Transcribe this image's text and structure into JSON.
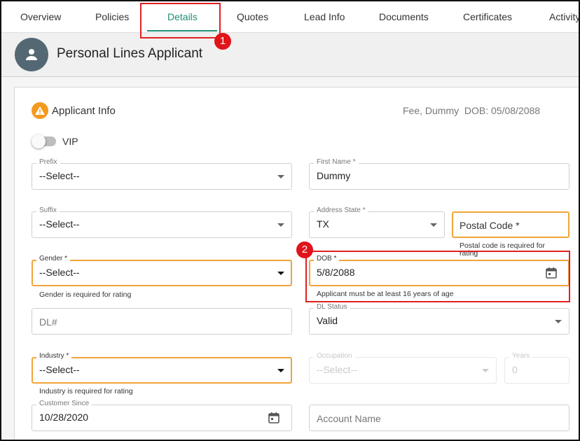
{
  "tabs": [
    {
      "label": "Overview"
    },
    {
      "label": "Policies"
    },
    {
      "label": "Details",
      "active": true
    },
    {
      "label": "Quotes"
    },
    {
      "label": "Lead Info"
    },
    {
      "label": "Documents"
    },
    {
      "label": "Certificates"
    },
    {
      "label": "Activity"
    }
  ],
  "header": {
    "title": "Personal Lines Applicant",
    "avatar_icon": "person-icon"
  },
  "section": {
    "title": "Applicant Info",
    "icon": "warning-icon",
    "summary_name": "Fee, Dummy",
    "summary_dob": "DOB: 05/08/2088"
  },
  "vip": {
    "label": "VIP",
    "on": false
  },
  "fields": {
    "prefix": {
      "label": "Prefix",
      "value": "--Select--"
    },
    "first_name": {
      "label": "First Name *",
      "value": "Dummy"
    },
    "suffix": {
      "label": "Suffix",
      "value": "--Select--"
    },
    "address_state": {
      "label": "Address State *",
      "value": "TX"
    },
    "postal_code": {
      "placeholder": "Postal Code *",
      "helper": "Postal code is required for rating"
    },
    "gender": {
      "label": "Gender *",
      "value": "--Select--",
      "helper": "Gender is required for rating"
    },
    "dob": {
      "label": "DOB *",
      "value": "5/8/2088",
      "helper": "Applicant must be at least 16 years of age"
    },
    "dl_number": {
      "placeholder": "DL#"
    },
    "dl_status": {
      "label": "DL Status",
      "value": "Valid"
    },
    "industry": {
      "label": "Industry *",
      "value": "--Select--",
      "helper": "Industry is required for rating"
    },
    "occupation": {
      "label": "Occupation",
      "value": "--Select--"
    },
    "years": {
      "label": "Years",
      "value": "0"
    },
    "customer_since": {
      "label": "Customer Since",
      "value": "10/28/2020"
    },
    "account_name": {
      "placeholder": "Account Name"
    }
  },
  "annotations": {
    "one": "1",
    "two": "2"
  },
  "colors": {
    "accent": "#1f8f77",
    "warning": "#f0a53a",
    "annotation": "#e02020"
  }
}
